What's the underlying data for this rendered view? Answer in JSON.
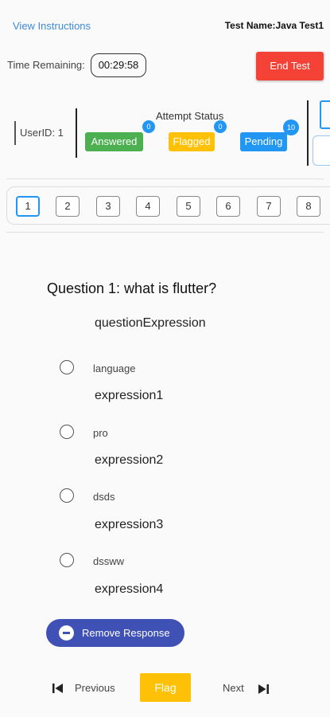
{
  "header": {
    "view_instructions": "View Instructions",
    "test_name": "Test Name:Java Test1"
  },
  "timer": {
    "label": "Time Remaining:",
    "value": "00:29:58",
    "end_test_label": "End Test"
  },
  "status": {
    "user_id": "UserID: 1",
    "attempt_title": "Attempt Status",
    "answered": {
      "label": "Answered",
      "count": "0",
      "color": "#4caf50"
    },
    "flagged": {
      "label": "Flagged",
      "count": "0",
      "color": "#ffc107"
    },
    "pending": {
      "label": "Pending",
      "count": "10",
      "color": "#2196f3"
    }
  },
  "question_nav": {
    "buttons": [
      "1",
      "2",
      "3",
      "4",
      "5",
      "6",
      "7",
      "8"
    ],
    "active": "1"
  },
  "question": {
    "title": "Question 1: what is flutter?",
    "expression": "questionExpression",
    "options": [
      {
        "label": "language",
        "expression": "expression1"
      },
      {
        "label": "pro",
        "expression": "expression2"
      },
      {
        "label": "dsds",
        "expression": "expression3"
      },
      {
        "label": "dssww",
        "expression": "expression4"
      }
    ]
  },
  "actions": {
    "remove_response": "Remove Response",
    "previous": "Previous",
    "flag": "Flag",
    "next": "Next"
  },
  "colors": {
    "accent": "#2196f3",
    "end_test": "#f44336",
    "remove_button": "#3f51b5",
    "flag_button": "#ffc107"
  },
  "icons": {
    "remove": "minus-circle-icon",
    "previous": "skip-previous-icon",
    "next": "skip-next-icon"
  }
}
